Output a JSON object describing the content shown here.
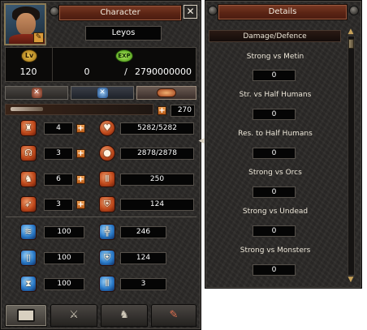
{
  "character_window": {
    "title": "Character",
    "name": "Leyos",
    "level_icon": "Lv",
    "exp_icon": "EXP",
    "level": "120",
    "exp_current": "0",
    "exp_separator": "/",
    "exp_max": "2790000000",
    "tab_buttons": [
      "sword-cross-icon",
      "blue-cross-icon",
      "emblem-icon"
    ],
    "available_points": "270",
    "stat_rows": [
      {
        "icon": "strength-icon",
        "value": "4",
        "derived_icon": "heart-icon",
        "derived_value": "5282/5282"
      },
      {
        "icon": "intelligence-icon",
        "value": "3",
        "derived_icon": "mana-orb-icon",
        "derived_value": "2878/2878"
      },
      {
        "icon": "dexterity-icon",
        "value": "6",
        "derived_icon": "attack-pillar-icon",
        "derived_value": "250"
      },
      {
        "icon": "vitality-icon",
        "value": "3",
        "derived_icon": "shield-icon",
        "derived_value": "124"
      }
    ],
    "extra_rows": [
      {
        "left_icon": "attack-speed-icon",
        "left_value": "100",
        "right_icon": "magic-attack-icon",
        "right_value": "246"
      },
      {
        "left_icon": "move-speed-icon",
        "left_value": "100",
        "right_icon": "magic-defence-icon",
        "right_value": "124"
      },
      {
        "left_icon": "cast-speed-icon",
        "left_value": "100",
        "right_icon": "evasion-icon",
        "right_value": "3"
      }
    ],
    "bottom_tabs": [
      "character-sheet-icon",
      "skills-sword-icon",
      "emotes-icon",
      "quest-scroll-icon"
    ]
  },
  "details_window": {
    "title": "Details",
    "section": "Damage/Defence",
    "rows": [
      {
        "label": "Strong vs Metin",
        "value": "0"
      },
      {
        "label": "Str. vs Half Humans",
        "value": "0"
      },
      {
        "label": "Res. to Half Humans",
        "value": "0"
      },
      {
        "label": "Strong vs Orcs",
        "value": "0"
      },
      {
        "label": "Strong vs Undead",
        "value": "0"
      },
      {
        "label": "Strong vs Monsters",
        "value": "0"
      }
    ]
  },
  "colors": {
    "panel_bg": "#2c2a28",
    "title_bar": "#5a2414",
    "accent_orange": "#d87a30",
    "stat_red": "#c04a1c",
    "stat_blue": "#2a7ac8"
  }
}
